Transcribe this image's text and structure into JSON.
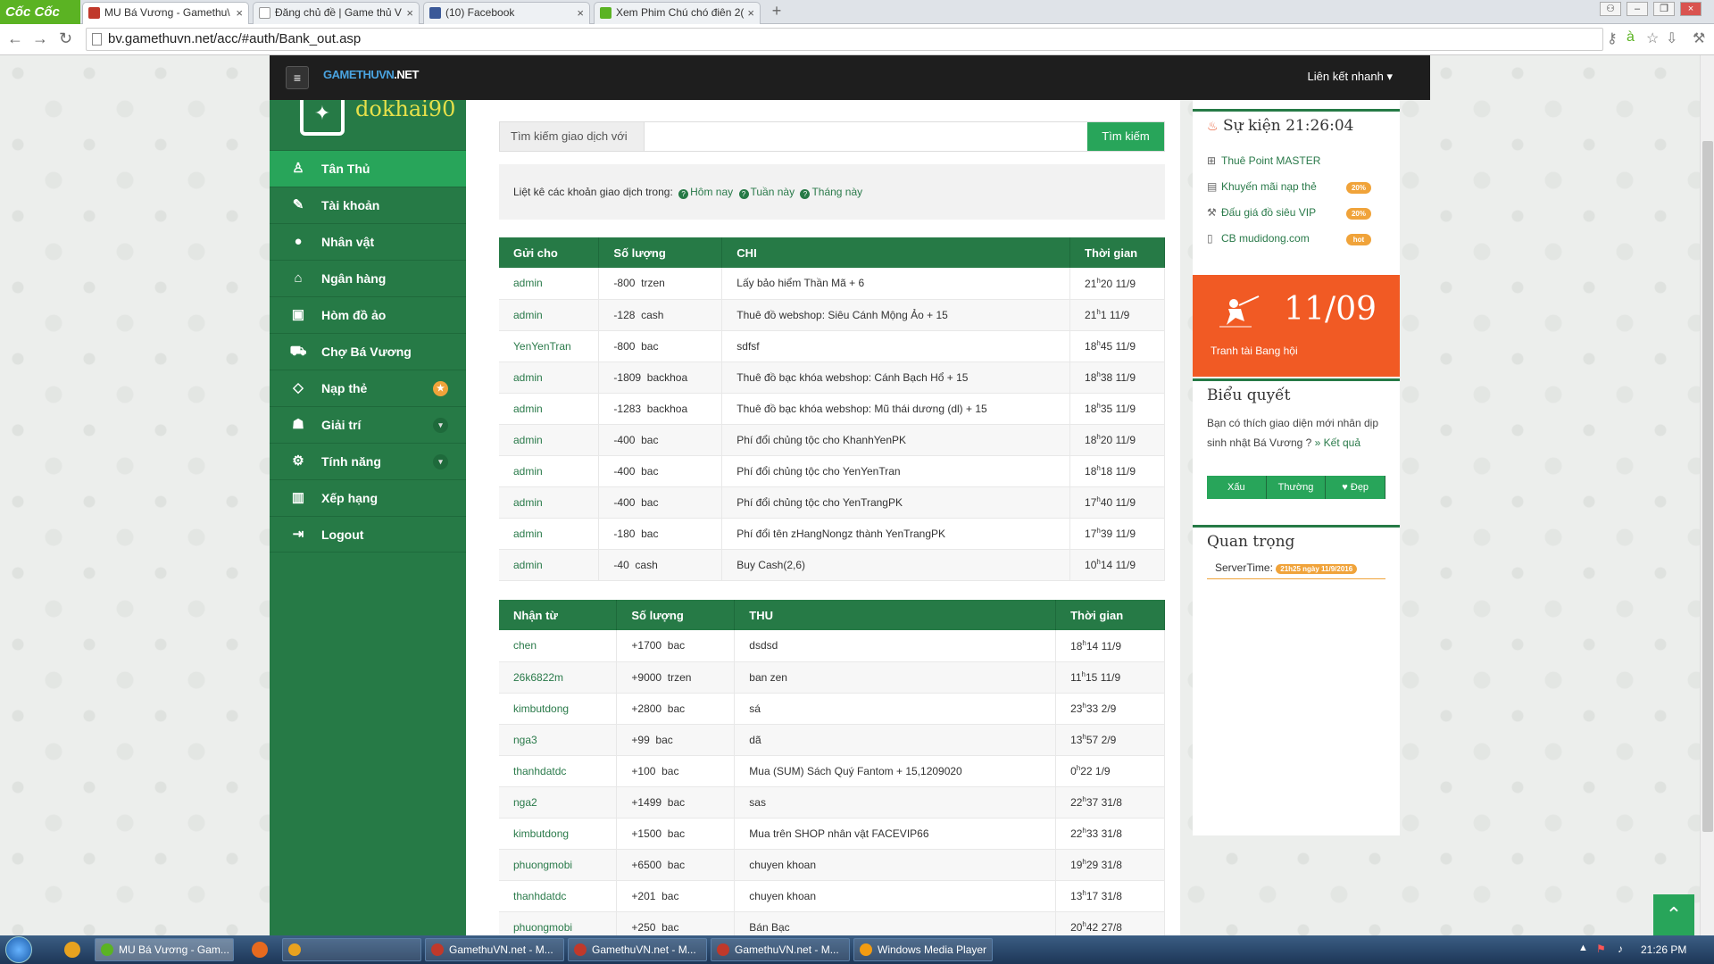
{
  "browser": {
    "brand": "Cốc Cốc",
    "tabs": [
      {
        "label": "MU Bá Vương - Gamethu\\",
        "active": true
      },
      {
        "label": "Đăng chủ đề | Game thủ V",
        "active": false
      },
      {
        "label": "(10) Facebook",
        "active": false
      },
      {
        "label": "Xem Phim Chú chó điên 2(",
        "active": false
      }
    ],
    "url": "bv.gamethuvn.net/acc/#auth/Bank_out.asp"
  },
  "site": {
    "logo_a": "GAMETHUVN",
    "logo_b": ".NET",
    "quick_links": "Liên kết nhanh",
    "username": "dokhai90"
  },
  "sidebar": {
    "items": [
      {
        "label": "Tân Thủ",
        "icon": "person-icon"
      },
      {
        "label": "Tài khoản",
        "icon": "edit-icon"
      },
      {
        "label": "Nhân vật",
        "icon": "user-icon"
      },
      {
        "label": "Ngân hàng",
        "icon": "bank-icon"
      },
      {
        "label": "Hòm đồ ảo",
        "icon": "briefcase-icon"
      },
      {
        "label": "Chợ Bá Vương",
        "icon": "cart-icon"
      },
      {
        "label": "Nạp thẻ",
        "icon": "diamond-icon"
      },
      {
        "label": "Giải trí",
        "icon": "android-icon"
      },
      {
        "label": "Tính năng",
        "icon": "gears-icon"
      },
      {
        "label": "Xếp hạng",
        "icon": "bar-chart-icon"
      },
      {
        "label": "Logout",
        "icon": "logout-icon"
      }
    ]
  },
  "search": {
    "label": "Tìm kiếm giao dịch với",
    "value": "",
    "button": "Tìm kiếm"
  },
  "filter": {
    "prefix": "Liệt kê các khoản giao dịch trong:",
    "today": "Hôm nay",
    "week": "Tuần này",
    "month": "Tháng này"
  },
  "outgoing": {
    "headers": [
      "Gửi cho",
      "Số lượng",
      "CHI",
      "Thời gian"
    ],
    "rows": [
      {
        "to": "admin",
        "amount": "-800",
        "unit": "trzen",
        "desc": "Lấy bảo hiểm Thần Mã + 6",
        "h": "21",
        "m": "20",
        "date": "11/9"
      },
      {
        "to": "admin",
        "amount": "-128",
        "unit": "cash",
        "desc": "Thuê đồ webshop: Siêu Cánh Mộng Ảo + 15",
        "h": "21",
        "m": "1",
        "date": "11/9"
      },
      {
        "to": "YenYenTran",
        "amount": "-800",
        "unit": "bac",
        "desc": "sdfsf",
        "h": "18",
        "m": "45",
        "date": "11/9"
      },
      {
        "to": "admin",
        "amount": "-1809",
        "unit": "backhoa",
        "desc": "Thuê đồ bạc khóa webshop: Cánh Bạch Hổ + 15",
        "h": "18",
        "m": "38",
        "date": "11/9"
      },
      {
        "to": "admin",
        "amount": "-1283",
        "unit": "backhoa",
        "desc": "Thuê đồ bạc khóa webshop: Mũ thái dương (dl) + 15",
        "h": "18",
        "m": "35",
        "date": "11/9"
      },
      {
        "to": "admin",
        "amount": "-400",
        "unit": "bac",
        "desc": "Phí đổi chủng tộc cho KhanhYenPK",
        "h": "18",
        "m": "20",
        "date": "11/9"
      },
      {
        "to": "admin",
        "amount": "-400",
        "unit": "bac",
        "desc": "Phí đổi chủng tộc cho YenYenTran",
        "h": "18",
        "m": "18",
        "date": "11/9"
      },
      {
        "to": "admin",
        "amount": "-400",
        "unit": "bac",
        "desc": "Phí đổi chủng tộc cho YenTrangPK",
        "h": "17",
        "m": "40",
        "date": "11/9"
      },
      {
        "to": "admin",
        "amount": "-180",
        "unit": "bac",
        "desc": "Phí đổi tên zHangNongz thành YenTrangPK",
        "h": "17",
        "m": "39",
        "date": "11/9"
      },
      {
        "to": "admin",
        "amount": "-40",
        "unit": "cash",
        "desc": "Buy Cash(2,6)",
        "h": "10",
        "m": "14",
        "date": "11/9"
      }
    ]
  },
  "incoming": {
    "headers": [
      "Nhận từ",
      "Số lượng",
      "THU",
      "Thời gian"
    ],
    "rows": [
      {
        "from": "chen",
        "amount": "+1700",
        "unit": "bac",
        "desc": "dsdsd",
        "h": "18",
        "m": "14",
        "date": "11/9"
      },
      {
        "from": "26k6822m",
        "amount": "+9000",
        "unit": "trzen",
        "desc": "ban zen",
        "h": "11",
        "m": "15",
        "date": "11/9"
      },
      {
        "from": "kimbutdong",
        "amount": "+2800",
        "unit": "bac",
        "desc": "sá",
        "h": "23",
        "m": "33",
        "date": "2/9"
      },
      {
        "from": "nga3",
        "amount": "+99",
        "unit": "bac",
        "desc": "dã",
        "h": "13",
        "m": "57",
        "date": "2/9"
      },
      {
        "from": "thanhdatdc",
        "amount": "+100",
        "unit": "bac",
        "desc": "Mua (SUM) Sách Quý Fantom + 15,1209020",
        "h": "0",
        "m": "22",
        "date": "1/9"
      },
      {
        "from": "nga2",
        "amount": "+1499",
        "unit": "bac",
        "desc": "sas",
        "h": "22",
        "m": "37",
        "date": "31/8"
      },
      {
        "from": "kimbutdong",
        "amount": "+1500",
        "unit": "bac",
        "desc": "Mua trên SHOP nhân vật FACEVIP66",
        "h": "22",
        "m": "33",
        "date": "31/8"
      },
      {
        "from": "phuongmobi",
        "amount": "+6500",
        "unit": "bac",
        "desc": "chuyen khoan",
        "h": "19",
        "m": "29",
        "date": "31/8"
      },
      {
        "from": "thanhdatdc",
        "amount": "+201",
        "unit": "bac",
        "desc": "chuyen khoan",
        "h": "13",
        "m": "17",
        "date": "31/8"
      },
      {
        "from": "phuongmobi",
        "amount": "+250",
        "unit": "bac",
        "desc": "Bán Bạc",
        "h": "20",
        "m": "42",
        "date": "27/8"
      }
    ]
  },
  "events": {
    "title": "Sự kiện 21:26:04",
    "items": [
      {
        "label": "Thuê Point MASTER",
        "badge": "",
        "icon": "gift-icon"
      },
      {
        "label": "Khuyến mãi nạp thẻ",
        "badge": "20%",
        "icon": "money-icon"
      },
      {
        "label": "Đấu giá đồ siêu VIP",
        "badge": "20%",
        "icon": "gavel-icon"
      },
      {
        "label": "CB mudidong.com",
        "badge": "hot",
        "icon": "mobile-icon"
      }
    ]
  },
  "promo": {
    "date": "11/09",
    "text": "Tranh tài Bang hội"
  },
  "poll": {
    "title": "Biểu quyết",
    "question": "Bạn có thích giao diện mới nhân dịp sinh nhật Bá Vương ?",
    "result_link": "» Kết quả",
    "options": [
      "Xấu",
      "Thường",
      "Đẹp"
    ]
  },
  "important": {
    "title": "Quan trọng",
    "server_label": "ServerTime:",
    "server_time": "21h25 ngày 11/9/2016"
  },
  "taskbar": {
    "items": [
      "MU Bá Vương - Gam...",
      "GamethuVN.net - M...",
      "GamethuVN.net - M...",
      "GamethuVN.net - M...",
      "Windows Media Player"
    ],
    "clock": "21:26 PM"
  },
  "colors": {
    "sidebar": "#267a46",
    "accent_green": "#28a55a",
    "promo_orange": "#f15a24",
    "badge_orange": "#f0a33a"
  }
}
